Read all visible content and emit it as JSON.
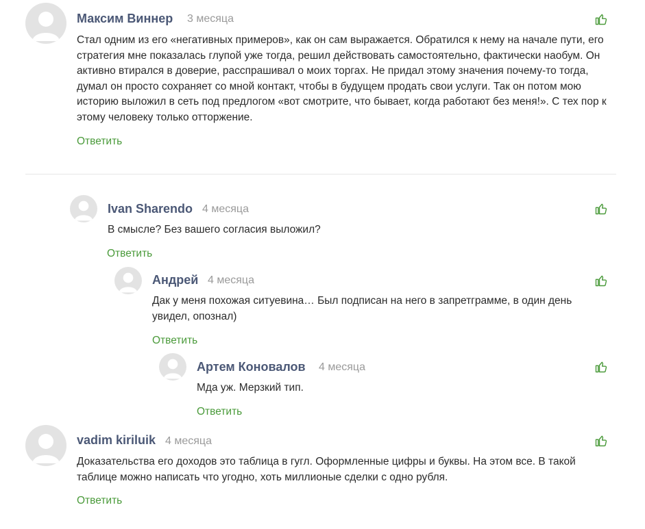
{
  "comments": [
    {
      "author": "Максим Виннер",
      "date": "3 месяца",
      "text": "Стал одним из его «негативных примеров», как он сам выражается. Обратился к нему на начале пути, его стратегия мне показалась глупой уже тогда, решил действовать самостоятельно, фактически наобум. Он активно втирался в доверие, расспрашивал о моих торгах. Не придал этому значения почему-то тогда, думал он просто сохраняет со мной контакт, чтобы в будущем продать свои услуги. Так он потом мою историю выложил в сеть под предлогом «вот смотрите, что бывает, когда работают без меня!». С тех пор к этому человеку только отторжение.",
      "reply": "Ответить"
    },
    {
      "author": "Ivan Sharendo",
      "date": "4 месяца",
      "text": "В смысле? Без вашего согласия выложил?",
      "reply": "Ответить"
    },
    {
      "author": "Андрей",
      "date": "4 месяца",
      "text": "Дак у меня похожая ситуевина… Был подписан на него в запретграмме, в один день увидел, опознал)",
      "reply": "Ответить"
    },
    {
      "author": "Артем Коновалов",
      "date": "4 месяца",
      "text": "Мда уж. Мерзкий тип.",
      "reply": "Ответить"
    },
    {
      "author": "vadim kiriluik",
      "date": "4 месяца",
      "text": "Доказательства его доходов это таблица в гугл. Оформленные цифры и буквы. На этом все. В такой таблице можно написать что угодно, хоть миллионые сделки с одно рубля.",
      "reply": "Ответить"
    }
  ],
  "icons": {
    "avatar": "user-avatar-placeholder",
    "like": "thumbs-up-icon"
  },
  "colors": {
    "name": "#4b5876",
    "date": "#9a9a9a",
    "reply": "#4a9a3a",
    "like": "#4a9a3a",
    "avatar_bg": "#e3e3e3"
  }
}
